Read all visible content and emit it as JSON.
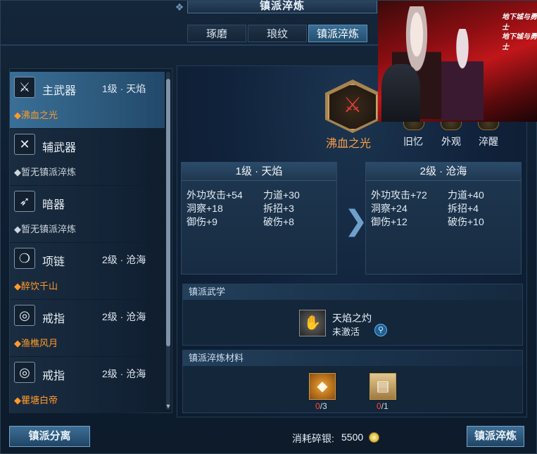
{
  "window": {
    "title": "镇派淬炼"
  },
  "tabs": [
    {
      "label": "琢磨",
      "active": false
    },
    {
      "label": "琅纹",
      "active": false
    },
    {
      "label": "镇派淬炼",
      "active": true
    }
  ],
  "equipment": [
    {
      "name": "主武器",
      "level": "1级 · 天焰",
      "status": "沸血之光",
      "status_color": "orange",
      "icon": "sword-icon",
      "selected": true
    },
    {
      "name": "辅武器",
      "level": "",
      "status": "暂无镇派淬炼",
      "status_color": "grey",
      "icon": "dual-blade-icon",
      "selected": false
    },
    {
      "name": "暗器",
      "level": "",
      "status": "暂无镇派淬炼",
      "status_color": "grey",
      "icon": "dart-icon",
      "selected": false
    },
    {
      "name": "项链",
      "level": "2级 · 沧海",
      "status": "醉饮千山",
      "status_color": "orange",
      "icon": "necklace-icon",
      "selected": false
    },
    {
      "name": "戒指",
      "level": "2级 · 沧海",
      "status": "渔樵风月",
      "status_color": "orange",
      "icon": "ring-icon",
      "selected": false
    },
    {
      "name": "戒指",
      "level": "2级 · 沧海",
      "status": "瞿塘白帝",
      "status_color": "orange",
      "icon": "ring-icon",
      "selected": false
    }
  ],
  "weapon": {
    "name": "沸血之光"
  },
  "subnav": [
    "旧忆",
    "外观",
    "淬醒"
  ],
  "current": {
    "header": "1级 · 天焰",
    "stats": [
      "外功攻击+54",
      "力道+30",
      "洞察+18",
      "拆招+3",
      "御伤+9",
      "破伤+8"
    ]
  },
  "next": {
    "header": "2级 · 沧海",
    "stats": [
      "外功攻击+72",
      "力道+40",
      "洞察+24",
      "拆招+4",
      "御伤+12",
      "破伤+10"
    ]
  },
  "arrow_glyph": "❯",
  "martial": {
    "title": "镇派武学",
    "skill_name": "天焰之灼",
    "skill_status": "未激活"
  },
  "materials": {
    "title": "镇派淬炼材料",
    "items": [
      {
        "icon": "crystal-icon",
        "have": "0",
        "need": "/3"
      },
      {
        "icon": "scroll-icon",
        "have": "0",
        "need": "/1"
      }
    ]
  },
  "footer": {
    "left_button": "镇派分离",
    "cost_label": "消耗碎银:",
    "cost_value": "5500",
    "right_button": "镇派淬炼"
  },
  "art": {
    "logo1": "地下城与勇士",
    "logo2": "地下城与勇士"
  }
}
